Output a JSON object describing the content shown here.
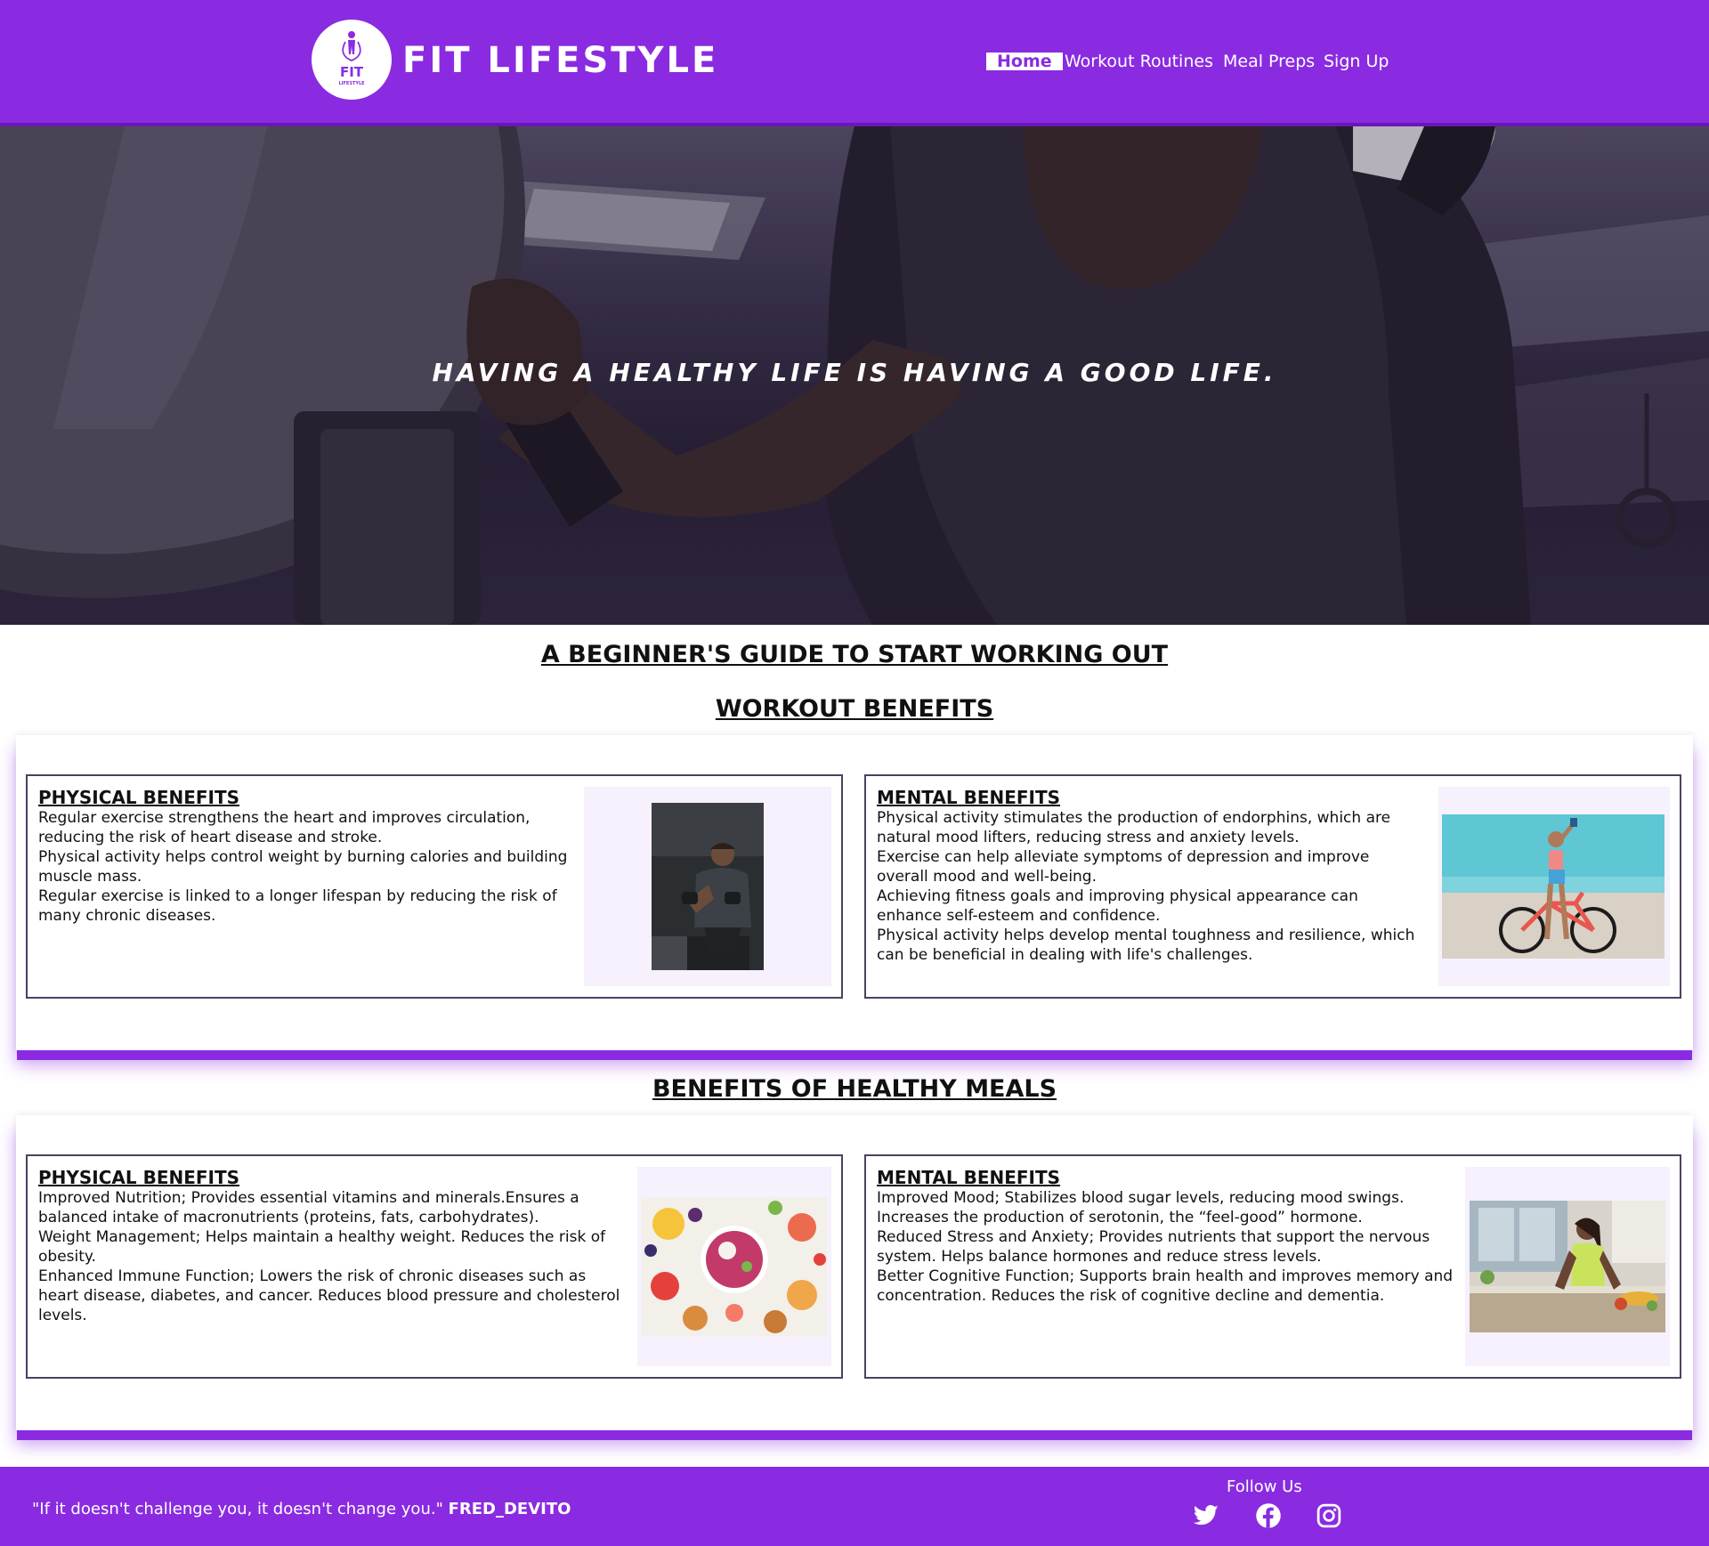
{
  "header": {
    "logo_text_top": "FIT",
    "logo_text_bottom": "LIFESTYLE",
    "brand": "FIT LIFESTYLE",
    "nav": [
      {
        "label": "Home",
        "active": true
      },
      {
        "label": "Workout Routines",
        "active": false
      },
      {
        "label": "Meal Preps",
        "active": false
      },
      {
        "label": "Sign Up",
        "active": false
      }
    ]
  },
  "hero": {
    "tagline": "HAVING A HEALTHY LIFE IS HAVING A GOOD LIFE."
  },
  "main": {
    "title": "A BEGINNER'S GUIDE TO START WORKING OUT",
    "sections": [
      {
        "title": "WORKOUT BENEFITS",
        "cards": [
          {
            "title": "PHYSICAL BENEFITS",
            "lines": [
              "Regular exercise strengthens the heart and improves circulation, reducing the risk of heart disease and stroke.",
              "Physical activity helps control weight by burning calories and building muscle mass.",
              "Regular exercise is linked to a longer lifespan by reducing the risk of many chronic diseases."
            ],
            "image": "man-dumbbells-photo"
          },
          {
            "title": "MENTAL BENEFITS",
            "lines": [
              "Physical activity stimulates the production of endorphins, which are natural mood lifters, reducing stress and anxiety levels.",
              "Exercise can help alleviate symptoms of depression and improve overall mood and well-being.",
              "Achieving fitness goals and improving physical appearance can enhance self-esteem and confidence.",
              "Physical activity helps develop mental toughness and resilience, which can be beneficial in dealing with life's challenges."
            ],
            "image": "woman-bicycle-beach-photo"
          }
        ]
      },
      {
        "title": "BENEFITS OF HEALTHY MEALS",
        "cards": [
          {
            "title": "PHYSICAL BENEFITS",
            "lines": [
              "Improved Nutrition; Provides essential vitamins and minerals.Ensures a balanced intake of macronutrients (proteins, fats, carbohydrates).",
              "Weight Management; Helps maintain a healthy weight. Reduces the risk of obesity.",
              "Enhanced Immune Function; Lowers the risk of chronic diseases such as heart disease, diabetes, and cancer. Reduces blood pressure and cholesterol levels."
            ],
            "image": "fruit-bowl-photo"
          },
          {
            "title": "MENTAL BENEFITS",
            "lines": [
              "Improved Mood; Stabilizes blood sugar levels, reducing mood swings. Increases the production of serotonin, the “feel-good” hormone.",
              "Reduced Stress and Anxiety; Provides nutrients that support the nervous system. Helps balance hormones and reduce stress levels.",
              "Better Cognitive Function; Supports brain health and improves memory and concentration. Reduces the risk of cognitive decline and dementia."
            ],
            "image": "woman-kitchen-photo"
          }
        ]
      }
    ]
  },
  "footer": {
    "quote": "\"If it doesn't challenge you, it doesn't change you.\"",
    "author": "FRED_DEVITO",
    "follow_label": "Follow Us",
    "social": [
      "twitter-icon",
      "facebook-icon",
      "instagram-icon"
    ]
  },
  "colors": {
    "brand_purple": "#8a2be2",
    "card_border": "#4d4060",
    "image_bg": "#f6f1fc"
  }
}
